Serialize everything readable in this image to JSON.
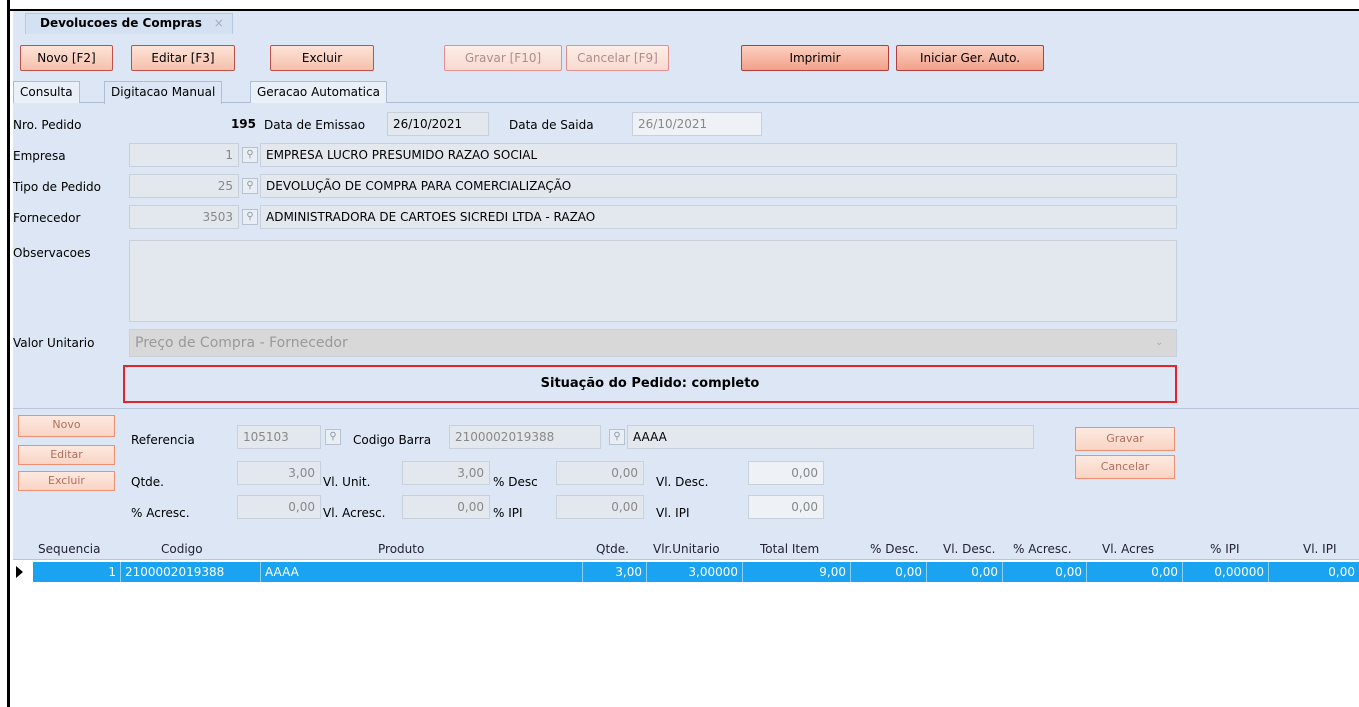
{
  "window": {
    "doc_tab": "Devolucoes de Compras",
    "close_glyph": "×"
  },
  "toolbar": {
    "novo": "Novo [F2]",
    "editar": "Editar [F3]",
    "excluir": "Excluir",
    "gravar": "Gravar [F10]",
    "cancelar": "Cancelar [F9]",
    "imprimir": "Imprimir",
    "iniciar": "Iniciar Ger. Auto."
  },
  "tabs": [
    "Consulta",
    "Digitacao Manual",
    "Geracao Automatica"
  ],
  "form": {
    "nro_pedido_label": "Nro. Pedido",
    "nro_pedido": "195",
    "data_emissao_label": "Data de Emissao",
    "data_emissao": "26/10/2021",
    "data_saida_label": "Data de Saida",
    "data_saida": "26/10/2021",
    "empresa_label": "Empresa",
    "empresa_code": "1",
    "empresa_name": "EMPRESA LUCRO PRESUMIDO RAZAO SOCIAL",
    "tipo_label": "Tipo de Pedido",
    "tipo_code": "25",
    "tipo_name": "DEVOLUÇÃO DE COMPRA PARA COMERCIALIZAÇÃO",
    "fornecedor_label": "Fornecedor",
    "fornecedor_code": "3503",
    "fornecedor_name": "ADMINISTRADORA DE CARTOES SICREDI LTDA - RAZAO",
    "observacoes_label": "Observacoes",
    "valor_unitario_label": "Valor Unitario",
    "valor_unitario": "Preço de Compra - Fornecedor",
    "status": "Situação do Pedido: completo"
  },
  "item": {
    "novo": "Novo",
    "editar": "Editar",
    "excluir": "Excluir",
    "referencia_label": "Referencia",
    "referencia": "105103",
    "codigo_barra_label": "Codigo Barra",
    "codigo_barra": "2100002019388",
    "produto": "AAAA",
    "qtde_label": "Qtde.",
    "qtde": "3,00",
    "vl_unit_label": "Vl. Unit.",
    "vl_unit": "3,00",
    "pct_desc_label": "% Desc",
    "pct_desc": "0,00",
    "vl_desc_label": "Vl. Desc.",
    "vl_desc": "0,00",
    "pct_acresc_label": "% Acresc.",
    "pct_acresc": "0,00",
    "vl_acresc_label": "Vl. Acresc.",
    "vl_acresc": "0,00",
    "pct_ipi_label": "% IPI",
    "pct_ipi": "0,00",
    "vl_ipi_label": "Vl. IPI",
    "vl_ipi": "0,00",
    "gravar": "Gravar",
    "cancelar": "Cancelar"
  },
  "grid": {
    "headers": [
      "Sequencia",
      "Codigo",
      "Produto",
      "Qtde.",
      "Vlr.Unitario",
      "Total Item",
      "% Desc.",
      "Vl. Desc.",
      "% Acresc.",
      "Vl. Acres",
      "% IPI",
      "Vl. IPI"
    ],
    "rows": [
      [
        "1",
        "2100002019388",
        "AAAA",
        "3,00",
        "3,00000",
        "9,00",
        "0,00",
        "0,00",
        "0,00",
        "0,00",
        "0,00000",
        "0,00"
      ]
    ]
  },
  "colors": {
    "accent_selection": "#1aa3f0",
    "status_border": "#e3242b",
    "button_border": "#c0504d"
  }
}
